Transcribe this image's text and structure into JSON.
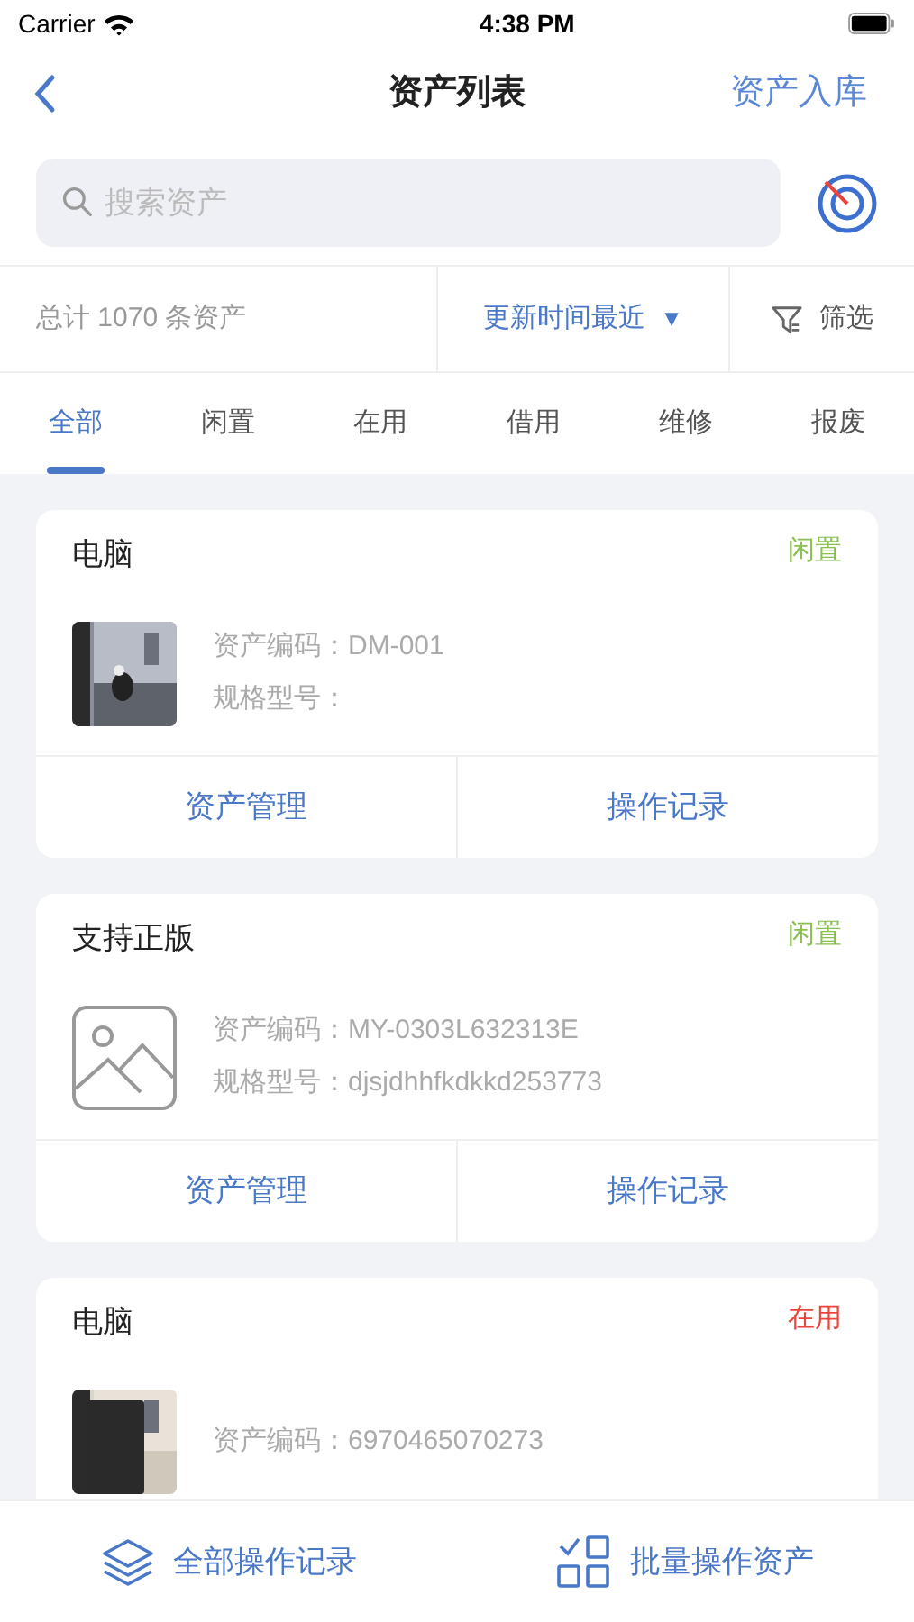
{
  "status_bar": {
    "carrier": "Carrier",
    "time": "4:38 PM"
  },
  "nav": {
    "title": "资产列表",
    "action": "资产入库"
  },
  "search": {
    "placeholder": "搜索资产"
  },
  "summary": {
    "total": "总计 1070 条资产",
    "sort": "更新时间最近",
    "sort_arrow": "▼",
    "filter": "筛选"
  },
  "tabs": [
    {
      "label": "全部",
      "selected": true
    },
    {
      "label": "闲置",
      "selected": false
    },
    {
      "label": "在用",
      "selected": false
    },
    {
      "label": "借用",
      "selected": false
    },
    {
      "label": "维修",
      "selected": false
    },
    {
      "label": "报废",
      "selected": false
    }
  ],
  "assets": [
    {
      "name": "电脑",
      "status": "闲置",
      "color": "#8cc152",
      "fields": [
        {
          "label": "资产编码：",
          "value": "DM-001"
        },
        {
          "label": "规格型号："
        }
      ],
      "actions": [
        "资产管理",
        "操作记录"
      ]
    },
    {
      "name": "支持正版",
      "status": "闲置",
      "color": "#8cc152",
      "kind": "placeholder",
      "fields": [
        {
          "label": "资产编码：",
          "value": "MY-0303L632313E"
        },
        {
          "label": "规格型号：",
          "value": "djsjdhhfkdkkd253773"
        }
      ],
      "actions": [
        "资产管理",
        "操作记录"
      ]
    },
    {
      "name": "电脑",
      "status": "在用",
      "color": "#e8453c",
      "fields": [
        {
          "label": "资产编码：",
          "value": "6970465070273"
        }
      ]
    }
  ],
  "bottom_bar": [
    {
      "label": "全部操作记录",
      "kind": "layers"
    },
    {
      "label": "批量操作资产",
      "kind": "batch"
    }
  ]
}
